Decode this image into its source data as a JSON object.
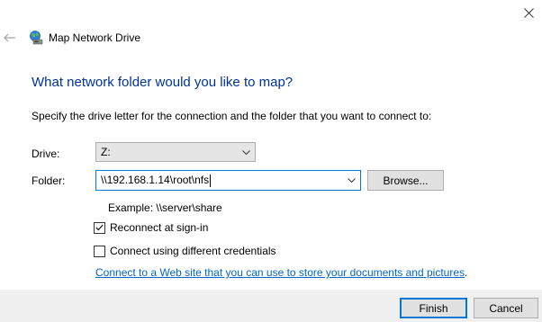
{
  "window": {
    "title": "Map Network Drive",
    "close_glyph": "✕",
    "back_glyph": "←",
    "title_icon": "network-drive-icon"
  },
  "main": {
    "heading": "What network folder would you like to map?",
    "instruction": "Specify the drive letter for the connection and the folder that you want to connect to:",
    "drive_label": "Drive:",
    "drive_value": "Z:",
    "folder_label": "Folder:",
    "folder_value": "\\\\192.168.1.14\\root\\nfs",
    "browse_label": "Browse...",
    "example_text": "Example: \\\\server\\share",
    "reconnect_label": "Reconnect at sign-in",
    "reconnect_checked": true,
    "credentials_label": "Connect using different credentials",
    "credentials_checked": false,
    "link_text": "Connect to a Web site that you can use to store your documents and pictures",
    "link_suffix": "."
  },
  "footer": {
    "finish_label": "Finish",
    "cancel_label": "Cancel"
  },
  "colors": {
    "heading": "#003399",
    "link": "#0066cc",
    "focus_border": "#0078d7",
    "footer_bg": "#f0f0f0",
    "button_bg": "#e1e1e1"
  }
}
